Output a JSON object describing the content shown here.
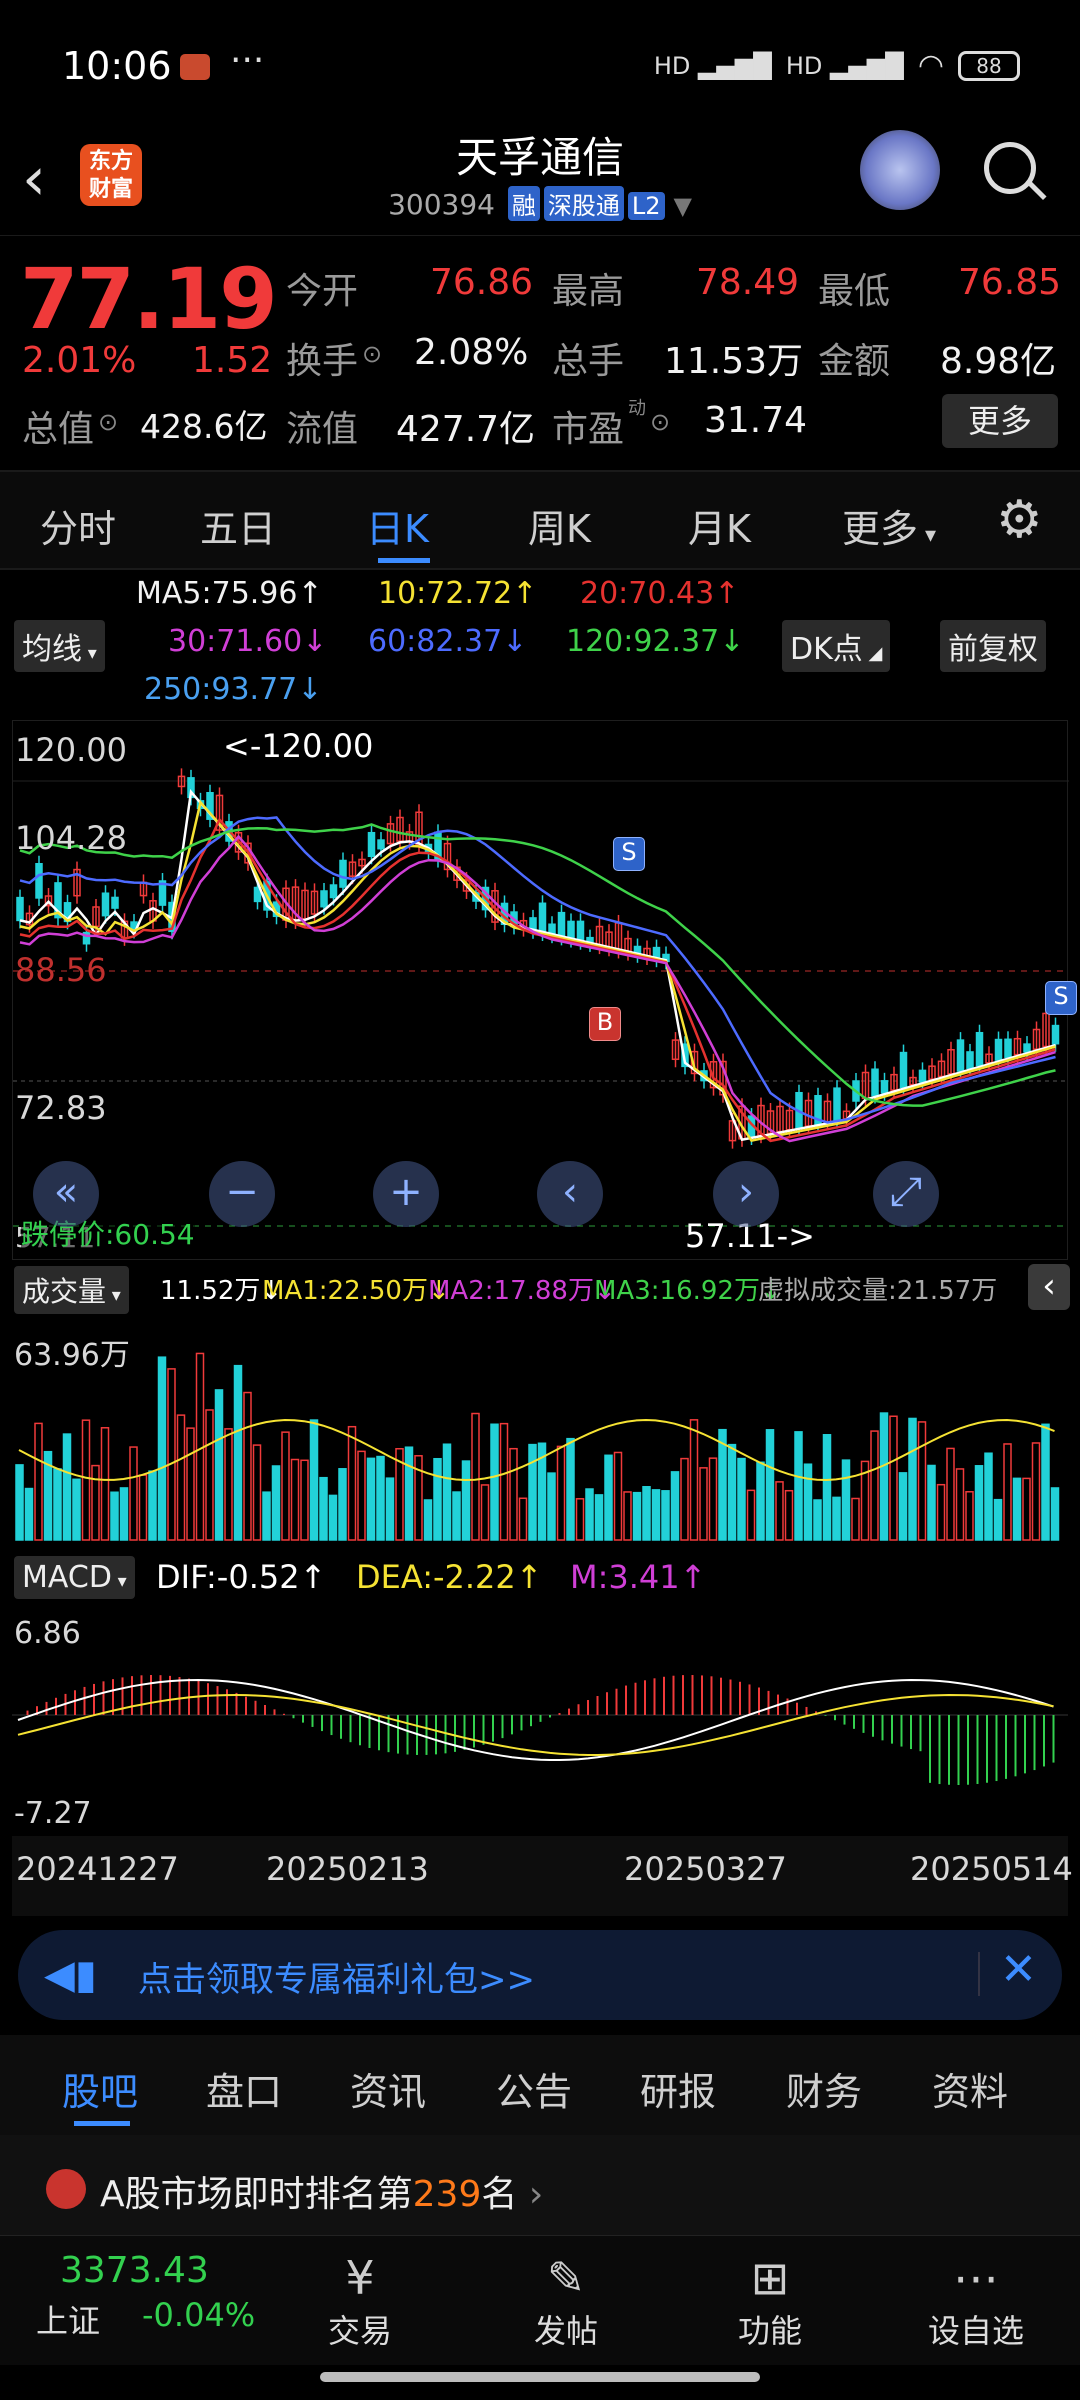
{
  "status_bar": {
    "time": "10:06",
    "battery": "88"
  },
  "header": {
    "logo_text": "东方财富",
    "title": "天孚通信",
    "code": "300394",
    "tags": [
      "融",
      "深股通",
      "L2"
    ]
  },
  "quote": {
    "price": "77.19",
    "change_pct": "2.01%",
    "change": "1.52",
    "open_label": "今开",
    "open": "76.86",
    "high_label": "最高",
    "high": "78.49",
    "low_label": "最低",
    "low": "76.85",
    "turnover_label": "换手",
    "turnover": "2.08%",
    "volume_label": "总手",
    "volume": "11.53万",
    "amount_label": "金额",
    "amount": "8.98亿",
    "mktcap_label": "总值",
    "mktcap": "428.6亿",
    "float_label": "流值",
    "float": "427.7亿",
    "pe_label": "市盈",
    "pe_sup": "动",
    "pe": "31.74",
    "more": "更多"
  },
  "tabs": [
    "分时",
    "五日",
    "日K",
    "周K",
    "月K",
    "更多"
  ],
  "ma": {
    "ma5": "MA5:75.96↑",
    "ma10": "10:72.72↑",
    "ma20": "20:70.43↑",
    "ma30": "30:71.60↓",
    "ma60": "60:82.37↓",
    "ma120": "120:92.37↓",
    "ma250": "250:93.77↓",
    "selector": "均线",
    "dk": "DK点",
    "adjust": "前复权"
  },
  "kchart": {
    "y_top": "120.00",
    "y_mid1": "104.28",
    "y_mid2": "88.56",
    "y_low": "72.83",
    "y_bottom": "57.11",
    "max_label": "<-120.00",
    "min_label": "57.11->",
    "stop_loss": "跌停价:60.54",
    "signal_s": "S",
    "signal_b": "B"
  },
  "volume": {
    "selector": "成交量",
    "vol": "11.52万↓",
    "ma1": "MA1:22.50万↓",
    "ma2": "MA2:17.88万↓",
    "ma3": "MA3:16.92万↓",
    "virtual": "虚拟成交量:21.57万",
    "y_top": "63.96万"
  },
  "macd": {
    "selector": "MACD",
    "dif": "DIF:-0.52↑",
    "dea": "DEA:-2.22↑",
    "m": "M:3.41↑",
    "y_top": "6.86",
    "y_bottom": "-7.27",
    "dates": [
      "20241227",
      "20250213",
      "20250327",
      "20250514"
    ]
  },
  "promo": {
    "text": "点击领取专属福利礼包>>"
  },
  "bottom_tabs": [
    "股吧",
    "盘口",
    "资讯",
    "公告",
    "研报",
    "财务",
    "资料"
  ],
  "rank": {
    "prefix": "A股市场即时排名第",
    "rank": "239",
    "suffix": "名"
  },
  "footer": {
    "index_value": "3373.43",
    "index_name": "上证",
    "index_change": "-0.04%",
    "items": [
      "交易",
      "发帖",
      "功能",
      "设自选"
    ]
  },
  "colors": {
    "up": "#f03a3a",
    "down": "#22d1d8",
    "accent": "#3c8cff",
    "ma5": "#ffffff",
    "ma10": "#f5e233",
    "ma20": "#e5322f",
    "ma30": "#d03fd6",
    "ma60": "#4d6bff",
    "ma120": "#3fd24a"
  }
}
